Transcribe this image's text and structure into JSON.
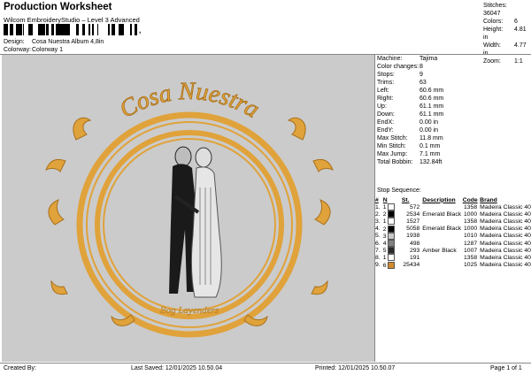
{
  "header": {
    "title": "Production Worksheet",
    "subtitle": "Wilcom EmbroideryStudio – Level 3 Advanced",
    "barcode_suffix": ","
  },
  "design": {
    "label": "Design:",
    "value": "Cosa Nuestra Album 4,8in"
  },
  "colorway": {
    "label": "Colorway:",
    "value": "Colorway 1"
  },
  "stats": [
    {
      "label": "Stitches:",
      "value": "36047"
    },
    {
      "label": "Colors:",
      "value": "6"
    },
    {
      "label": "Height:",
      "value": "4.81 in"
    },
    {
      "label": "Width:",
      "value": "4.77 in"
    },
    {
      "label": "Zoom:",
      "value": "1:1"
    }
  ],
  "artwork": {
    "arc_text": "Cosa Nuestra",
    "signature_text": "Bog Layenders",
    "colors": {
      "gold": "#e0a23a",
      "gold_dark": "#a8711c",
      "canvas": "#cbcbcb"
    }
  },
  "machine": [
    {
      "label": "Machine:",
      "value": "Tajima"
    },
    {
      "label": "Color changes:",
      "value": "8"
    },
    {
      "label": "Stops:",
      "value": "9"
    },
    {
      "label": "Trims:",
      "value": "63"
    },
    {
      "label": "Left:",
      "value": "60.6 mm"
    },
    {
      "label": "Right:",
      "value": "60.6 mm"
    },
    {
      "label": "Up:",
      "value": "61.1 mm"
    },
    {
      "label": "Down:",
      "value": "61.1 mm"
    },
    {
      "label": "EndX:",
      "value": "0.00 in"
    },
    {
      "label": "EndY:",
      "value": "0.00 in"
    },
    {
      "label": "Max Stitch:",
      "value": "11.8 mm"
    },
    {
      "label": "Min Stitch:",
      "value": "0.1 mm"
    },
    {
      "label": "Max Jump:",
      "value": "7.1 mm"
    },
    {
      "label": "Total Bobbin:",
      "value": "132.84ft"
    }
  ],
  "stop_sequence": {
    "title": "Stop Sequence:",
    "headers": [
      "#",
      "N",
      "St.",
      "Description",
      "Code",
      "Brand"
    ],
    "rows": [
      {
        "n": "1.",
        "num": "1",
        "color": "#ffffff",
        "st": "572",
        "desc": "",
        "code": "1358",
        "brand": "Madeira Classic 40"
      },
      {
        "n": "2.",
        "num": "2",
        "color": "#000000",
        "st": "2534",
        "desc": "Emerald Black",
        "code": "1000",
        "brand": "Madeira Classic 40"
      },
      {
        "n": "3.",
        "num": "1",
        "color": "#ffffff",
        "st": "1527",
        "desc": "",
        "code": "1358",
        "brand": "Madeira Classic 40"
      },
      {
        "n": "4.",
        "num": "2",
        "color": "#000000",
        "st": "5058",
        "desc": "Emerald Black",
        "code": "1000",
        "brand": "Madeira Classic 40"
      },
      {
        "n": "5.",
        "num": "3",
        "color": "#c8c8c8",
        "st": "1938",
        "desc": "",
        "code": "1010",
        "brand": "Madeira Classic 40"
      },
      {
        "n": "6.",
        "num": "4",
        "color": "#808080",
        "st": "498",
        "desc": "",
        "code": "1287",
        "brand": "Madeira Classic 40"
      },
      {
        "n": "7.",
        "num": "5",
        "color": "#2a2a2a",
        "st": "293",
        "desc": "Amber Black",
        "code": "1007",
        "brand": "Madeira Classic 40"
      },
      {
        "n": "8.",
        "num": "1",
        "color": "#ffffff",
        "st": "191",
        "desc": "",
        "code": "1358",
        "brand": "Madeira Classic 40"
      },
      {
        "n": "9.",
        "num": "6",
        "color": "#d08a2c",
        "st": "25434",
        "desc": "",
        "code": "1025",
        "brand": "Madeira Classic 40"
      }
    ]
  },
  "footer": {
    "created_by": "Created By:",
    "last_saved": "Last Saved: 12/01/2025 10.50.04",
    "printed": "Printed: 12/01/2025 10.50.07",
    "page": "Page 1 of 1"
  }
}
